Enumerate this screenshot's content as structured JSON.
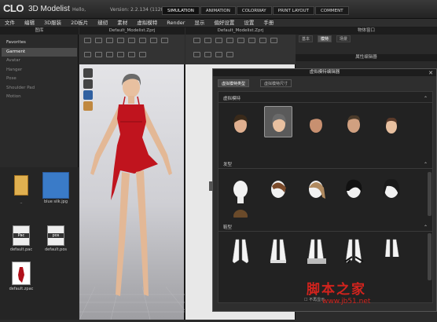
{
  "app": {
    "logo": "CLO",
    "product": "3D Modelist",
    "hello": "Hello,",
    "version": "Version: 2.2.134",
    "build": "(11288)"
  },
  "mode_tabs": [
    "SIMULATION",
    "ANIMATION",
    "COLORWAY",
    "PRINT LAYOUT",
    "COMMENT"
  ],
  "menu": [
    "文件",
    "编辑",
    "3D服装",
    "2D板片",
    "缝纫",
    "素材",
    "虚拟模特",
    "Render",
    "显示",
    "偏好设置",
    "设置",
    "手册"
  ],
  "library": {
    "title": "图库",
    "nav": [
      "Favorites",
      "Garment",
      "Avatar",
      "Hanger",
      "Pose",
      "Shoulder Pad",
      "Motion"
    ],
    "selected": "Garment",
    "files": [
      "..",
      "blue silk.jpg",
      "default.pac",
      "default.pos",
      "default.zpac"
    ],
    "file_icon_labels": [
      "Pac",
      "pos"
    ]
  },
  "view3d": {
    "title": "Default_Modelist.Zprj"
  },
  "view2d": {
    "title": "Default_Modelist.Zprj"
  },
  "right": {
    "top_title": "物体窗口",
    "tabs": [
      "基本",
      "模特",
      "场景"
    ],
    "prop_title": "属性编辑器"
  },
  "editor": {
    "title": "虚拟模特编辑器",
    "tabs": [
      "虚拟模特类型",
      "虚拟模特尺寸"
    ],
    "sections": [
      "虚拟模特",
      "发型",
      "鞋型"
    ],
    "hide_label": "不再显示"
  },
  "watermark": {
    "text": "脚本之家",
    "url": "www.jb51.net"
  },
  "colors": {
    "dress": "#c0141e",
    "watermark": "#d2231d",
    "accent": "#4a90d9"
  }
}
